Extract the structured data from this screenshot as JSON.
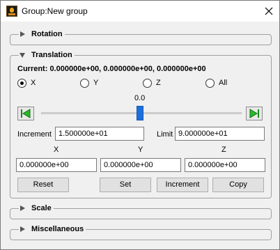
{
  "window": {
    "title": "Group:New group",
    "icons": {
      "app": "app-icon",
      "close": "close-icon"
    }
  },
  "sections": {
    "rotation": {
      "label": "Rotation",
      "expanded": false
    },
    "translation": {
      "label": "Translation",
      "expanded": true
    },
    "scale": {
      "label": "Scale",
      "expanded": false
    },
    "miscellaneous": {
      "label": "Miscellaneous",
      "expanded": false
    }
  },
  "translation": {
    "current": "Current: 0.000000e+00, 0.000000e+00, 0.000000e+00",
    "axes": [
      {
        "label": "X",
        "selected": true
      },
      {
        "label": "Y",
        "selected": false
      },
      {
        "label": "Z",
        "selected": false
      },
      {
        "label": "All",
        "selected": false
      }
    ],
    "slider": {
      "value_text": "0.0",
      "position_fraction": 0.5
    },
    "increment": {
      "label": "Increment",
      "value": "1.500000e+01"
    },
    "limit": {
      "label": "Limit",
      "value": "9.000000e+01"
    },
    "coord_headers": [
      "X",
      "Y",
      "Z"
    ],
    "coord_values": [
      "0.000000e+00",
      "0.000000e+00",
      "0.000000e+00"
    ],
    "buttons": {
      "reset": "Reset",
      "set": "Set",
      "increment": "Increment",
      "copy": "Copy"
    }
  },
  "colors": {
    "accent": "#1e6fd9",
    "step_arrow": "#1a8a1a",
    "app_icon": "#f2a71b"
  }
}
